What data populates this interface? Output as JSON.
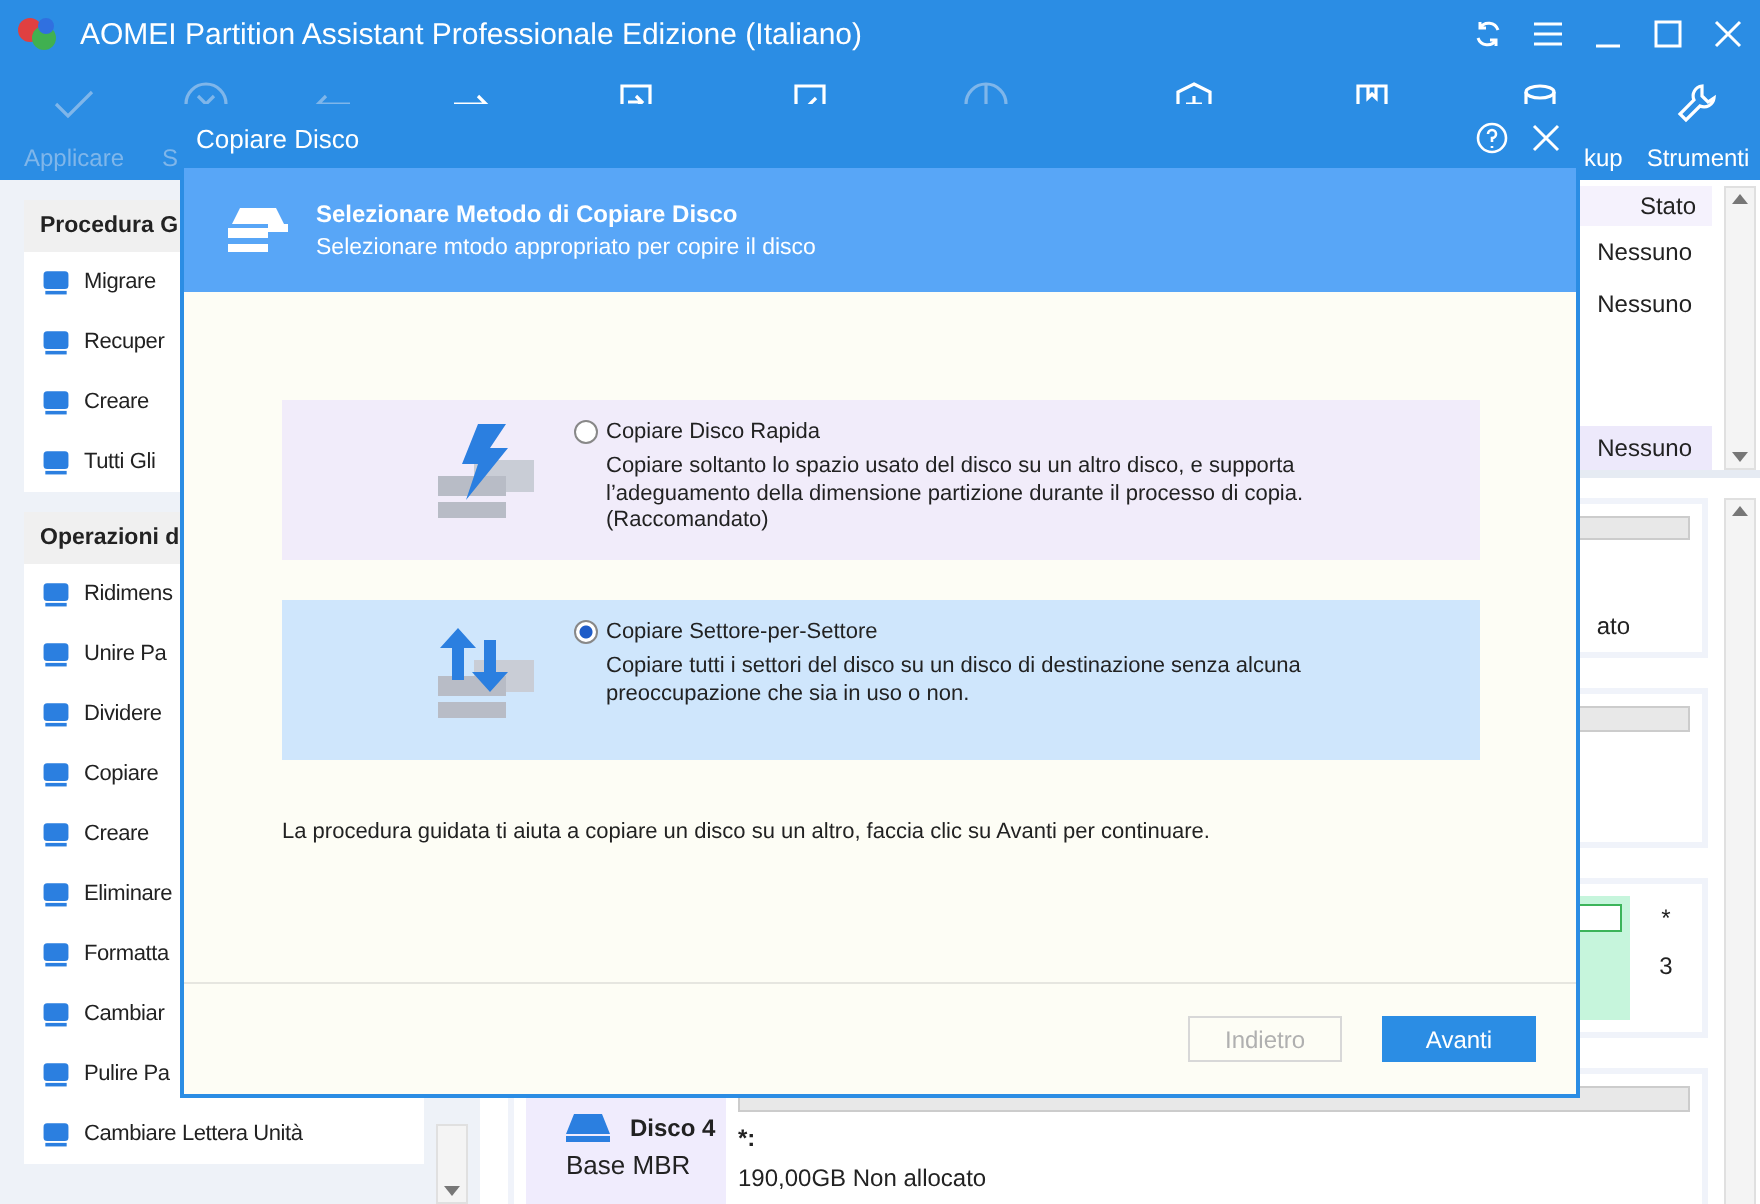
{
  "app": {
    "title": "AOMEI Partition Assistant Professionale Edizione (Italiano)"
  },
  "toolbar": [
    {
      "label": "Applicare",
      "disabled": true
    },
    {
      "label": "S",
      "disabled": true
    },
    {
      "disabled": true
    },
    {
      "disabled": false
    },
    {
      "disabled": false
    },
    {
      "disabled": false
    },
    {
      "disabled": true
    },
    {
      "disabled": false
    },
    {
      "disabled": false
    },
    {
      "label": "kup",
      "disabled": false
    },
    {
      "label": "Strumenti",
      "disabled": false
    }
  ],
  "sidebar": [
    {
      "title": "Procedura G",
      "items": [
        "Migrare",
        "Recuper",
        "Creare",
        "Tutti Gli"
      ]
    },
    {
      "title": "Operazioni d",
      "items": [
        "Ridimens",
        "Unire Pa",
        "Dividere",
        "Copiare",
        "Creare",
        "Eliminare",
        "Formatta",
        "Cambiar",
        "Pulire Pa",
        "Cambiare Lettera Unità"
      ]
    }
  ],
  "partition_table": {
    "columns": [
      "Stato"
    ],
    "rows": [
      {
        "status": "Nessuno",
        "selected": false
      },
      {
        "status": "Nessuno",
        "selected": false
      },
      {
        "status": "Nessuno",
        "selected": true
      }
    ]
  },
  "disk_map": [
    {
      "kind": "text",
      "text": "ato"
    },
    {
      "kind": "empty"
    },
    {
      "kind": "split",
      "labels": [
        "*",
        "3"
      ]
    },
    {
      "kind": "disk",
      "name": "Disco 4",
      "type": "Base MBR",
      "letter": "*:",
      "info": "190,00GB Non allocato"
    }
  ],
  "dialog": {
    "title": "Copiare Disco",
    "heading": "Selezionare Metodo di Copiare Disco",
    "subheading": "Selezionare mtodo appropriato per copire il disco",
    "options": [
      {
        "kind": "fast",
        "label": "Copiare Disco Rapida",
        "description": "Copiare soltanto lo spazio usato del disco su un altro disco, e supporta l’adeguamento della dimensione partizione durante il processo di copia.(Raccomandato)",
        "selected": false
      },
      {
        "kind": "sector",
        "label": "Copiare Settore-per-Settore",
        "description": "Copiare tutti i settori del disco su un disco di destinazione senza alcuna preoccupazione che sia in uso o non.",
        "selected": true
      }
    ],
    "note": "La procedura guidata ti aiuta a copiare un disco su un altro, faccia clic su Avanti per continuare.",
    "buttons": [
      {
        "label": "Indietro",
        "disabled": true
      },
      {
        "label": "Avanti",
        "disabled": false
      }
    ]
  }
}
